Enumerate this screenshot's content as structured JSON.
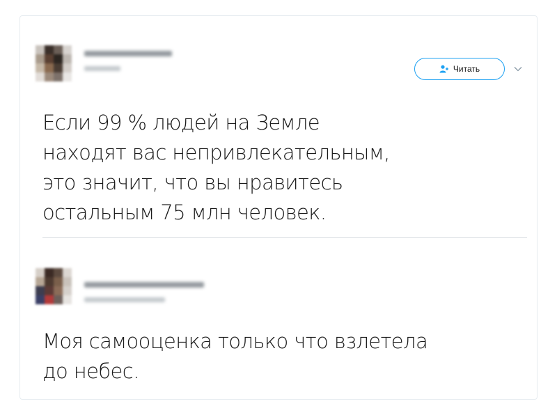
{
  "tweets": [
    {
      "text": "Если 99 % людей на Земле\nнаходят вас непривлекательным,\nэто значит, что вы нравитесь\nостальным 75 млн человек.",
      "follow_label": "Читать"
    },
    {
      "text": "Моя самооценка только что взлетела\nдо небес."
    }
  ],
  "colors": {
    "accent": "#1da1f2",
    "text": "#1a1a1a",
    "border": "#e6ecf0",
    "blur_gray": "#6e767d"
  },
  "icons": [
    "follow-person-icon",
    "chevron-down-icon"
  ]
}
